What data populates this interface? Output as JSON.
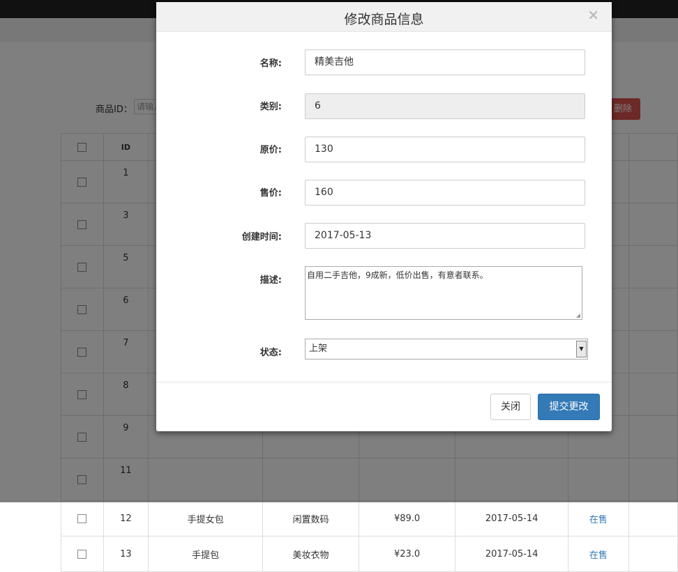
{
  "background": {
    "search_label": "商品ID：",
    "search_placeholder": "请输入",
    "delete_label": "删除",
    "table_header_id": "ID",
    "rows": [
      {
        "id": "1",
        "name": "",
        "category": "",
        "price": "",
        "date": "",
        "status": ""
      },
      {
        "id": "3",
        "name": "",
        "category": "",
        "price": "",
        "date": "",
        "status": ""
      },
      {
        "id": "5",
        "name": "",
        "category": "",
        "price": "",
        "date": "",
        "status": ""
      },
      {
        "id": "6",
        "name": "",
        "category": "",
        "price": "",
        "date": "",
        "status": ""
      },
      {
        "id": "7",
        "name": "",
        "category": "",
        "price": "",
        "date": "",
        "status": ""
      },
      {
        "id": "8",
        "name": "",
        "category": "",
        "price": "",
        "date": "",
        "status": ""
      },
      {
        "id": "9",
        "name": "",
        "category": "",
        "price": "",
        "date": "",
        "status": ""
      },
      {
        "id": "11",
        "name": "",
        "category": "",
        "price": "",
        "date": "",
        "status": ""
      },
      {
        "id": "12",
        "name": "手提女包",
        "category": "闲置数码",
        "price": "¥89.0",
        "date": "2017-05-14",
        "status": "在售"
      },
      {
        "id": "13",
        "name": "手提包",
        "category": "美妆衣物",
        "price": "¥23.0",
        "date": "2017-05-14",
        "status": "在售"
      }
    ]
  },
  "modal": {
    "title": "修改商品信息",
    "close_symbol": "×",
    "fields": {
      "name_label": "名称:",
      "name_value": "精美吉他",
      "category_label": "类别:",
      "category_value": "6",
      "original_price_label": "原价:",
      "original_price_value": "130",
      "sale_price_label": "售价:",
      "sale_price_value": "160",
      "created_label": "创建时间:",
      "created_value": "2017-05-13",
      "description_label": "描述:",
      "description_value": "自用二手吉他，9成新，低价出售，有意者联系。",
      "status_label": "状态:",
      "status_value": "上架"
    },
    "close_button": "关闭",
    "submit_button": "提交更改"
  },
  "colors": {
    "primary": "#337ab7",
    "danger": "#d9534f",
    "link": "#337ab7"
  }
}
